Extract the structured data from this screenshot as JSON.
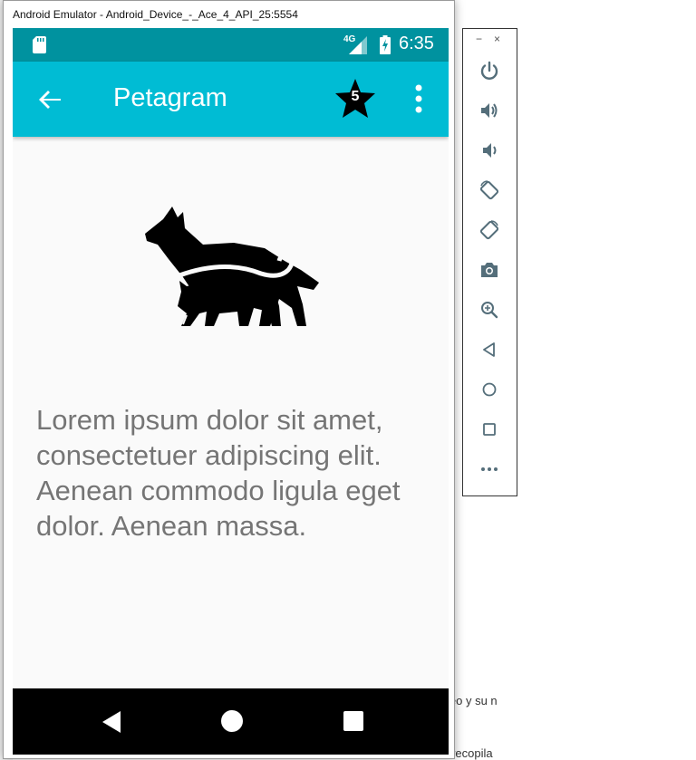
{
  "window": {
    "title": "Android Emulator - Android_Device_-_Ace_4_API_25:5554"
  },
  "status_bar": {
    "network_label": "4G",
    "time": "6:35"
  },
  "app_bar": {
    "title": "Petagram",
    "favorites_count": "5"
  },
  "content": {
    "body": "Lorem ipsum dolor sit amet, consectetuer adipiscing elit. Aenean commodo ligula eget dolor. Aenean massa."
  },
  "background_text": {
    "line1": "orreo y su n",
    "line2": "on recopila"
  },
  "side_panel": {
    "minimize_label": "−",
    "close_label": "×",
    "buttons": [
      {
        "icon": "power-icon"
      },
      {
        "icon": "volume-up-icon"
      },
      {
        "icon": "volume-down-icon"
      },
      {
        "icon": "rotate-left-icon"
      },
      {
        "icon": "rotate-right-icon"
      },
      {
        "icon": "camera-icon"
      },
      {
        "icon": "zoom-icon"
      },
      {
        "icon": "back-icon"
      },
      {
        "icon": "home-icon"
      },
      {
        "icon": "overview-icon"
      },
      {
        "icon": "more-icon"
      }
    ]
  },
  "colors": {
    "status_bar": "#00929f",
    "app_bar": "#00bcd4",
    "body_text": "#757575",
    "nav_bar": "#000000"
  }
}
